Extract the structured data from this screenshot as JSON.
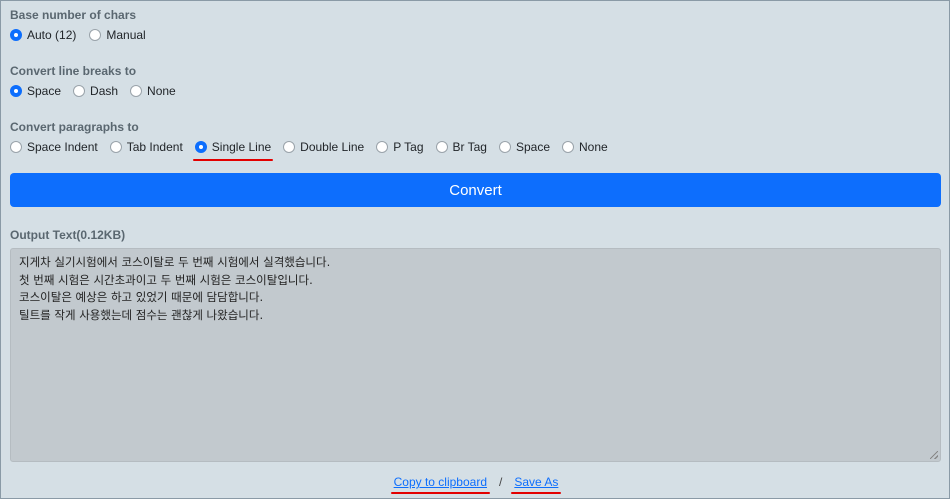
{
  "base_chars": {
    "label": "Base number of chars",
    "options": [
      "Auto (12)",
      "Manual"
    ],
    "selected": 0
  },
  "line_breaks": {
    "label": "Convert line breaks to",
    "options": [
      "Space",
      "Dash",
      "None"
    ],
    "selected": 0
  },
  "paragraphs": {
    "label": "Convert paragraphs to",
    "options": [
      "Space Indent",
      "Tab Indent",
      "Single Line",
      "Double Line",
      "P Tag",
      "Br Tag",
      "Space",
      "None"
    ],
    "selected": 2
  },
  "convert_button": "Convert",
  "output": {
    "label": "Output Text(0.12KB)",
    "lines": [
      "지게차 실기시험에서 코스이탈로 두 번째 시험에서 실격했습니다.",
      "첫 번째 시험은 시간초과이고 두 번째 시험은 코스이탈입니다.",
      "코스이탈은 예상은 하고 있었기 때문에 담담합니다.",
      "틸트를 작게 사용했는데 점수는 괜찮게 나왔습니다."
    ]
  },
  "links": {
    "copy": "Copy to clipboard",
    "separator": "/",
    "save": "Save As"
  },
  "colors": {
    "accent": "#0d6efd",
    "annotation": "#e30000",
    "background": "#d5dfe5"
  }
}
